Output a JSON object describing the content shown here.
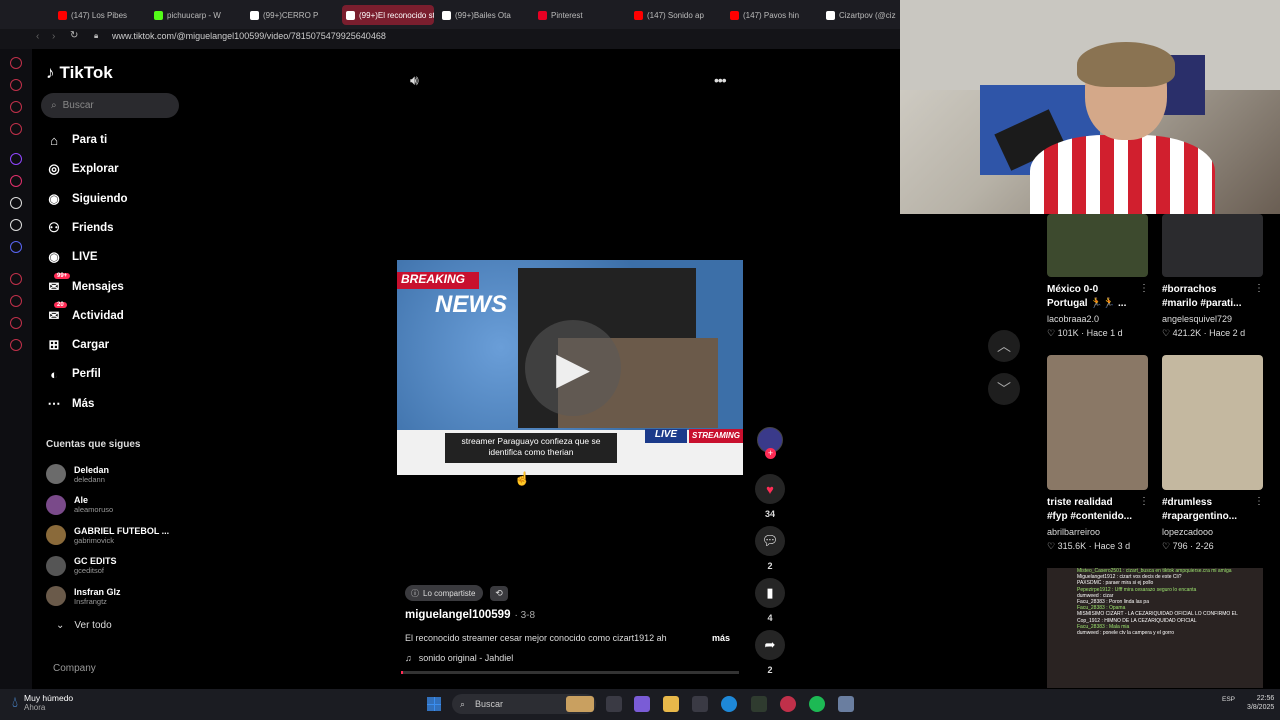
{
  "browser": {
    "tabs": [
      {
        "label": "(147) Los Pibes",
        "color": "#ff0000"
      },
      {
        "label": "pichuucarp - W",
        "color": "#53fc18"
      },
      {
        "label": "(99+)CERRO P",
        "color": "#ffffff"
      },
      {
        "label": "(99+)El reconocido st",
        "color": "#ffffff"
      },
      {
        "label": "(99+)Bailes Ota",
        "color": "#ffffff"
      },
      {
        "label": "Pinterest",
        "color": "#e60023"
      },
      {
        "label": "(147) Sonido ap",
        "color": "#ff0000"
      },
      {
        "label": "(147) Pavos hin",
        "color": "#ff0000"
      },
      {
        "label": "Cizartpov (@ciz",
        "color": "#ffffff"
      }
    ],
    "url": "www.tiktok.com/@miguelangel100599/video/7815075479925640468"
  },
  "tiktok": {
    "logo": "TikTok",
    "search_placeholder": "Buscar",
    "nav": [
      {
        "label": "Para ti",
        "icon": "home-icon"
      },
      {
        "label": "Explorar",
        "icon": "compass-icon"
      },
      {
        "label": "Siguiendo",
        "icon": "following-icon"
      },
      {
        "label": "Friends",
        "icon": "friends-icon"
      },
      {
        "label": "LIVE",
        "icon": "live-icon"
      },
      {
        "label": "Mensajes",
        "icon": "messages-icon",
        "badge": "99+"
      },
      {
        "label": "Actividad",
        "icon": "activity-icon",
        "badge": "20"
      },
      {
        "label": "Cargar",
        "icon": "upload-icon"
      },
      {
        "label": "Perfil",
        "icon": "profile-icon"
      },
      {
        "label": "Más",
        "icon": "more-icon"
      }
    ],
    "following_title": "Cuentas que sigues",
    "following": [
      {
        "name": "Deledan",
        "handle": "deledann",
        "color": "#6b6b6b"
      },
      {
        "name": "Ale",
        "handle": "aleamoruso",
        "color": "#7a4a8a"
      },
      {
        "name": "GABRIEL FUTEBOL ...",
        "handle": "gabrimovick",
        "color": "#8a6a3a"
      },
      {
        "name": "GC EDITS",
        "handle": "gceditsof",
        "color": "#555555"
      },
      {
        "name": "Insfran Glz",
        "handle": "Insfrangtz",
        "color": "#6a5a4a"
      }
    ],
    "see_all": "Ver todo",
    "company": "Company"
  },
  "video": {
    "breaking": "BREAKING",
    "news": "NEWS",
    "caption": "streamer Paraguayo confieza que se identifica como therian",
    "live": "LIVE",
    "streaming": "STREAMING",
    "share_badge": "Lo compartiste",
    "author": "miguelangel100599",
    "date": "· 3-8",
    "description": "El reconocido streamer cesar mejor conocido como cizart1912 ah",
    "more": "más",
    "sound": "sonido original - Jahdiel",
    "likes": "34",
    "comments": "2",
    "saves": "4",
    "shares": "2",
    "progress": 0.0
  },
  "recommended": [
    {
      "title": "México 0-0 Portugal 🏃🏃 ...",
      "author": "lacobraaa2.0",
      "likes": "101K",
      "age": "Hace 1 d",
      "thumb": "#3d4a2e"
    },
    {
      "title": "#borrachos #marilo #parati...",
      "author": "angelesquivel729",
      "likes": "421.2K",
      "age": "Hace 2 d",
      "thumb": "#2b2b2e"
    },
    {
      "title": "triste realidad #fyp #contenido...",
      "author": "abrilbarreiroo",
      "likes": "315.6K",
      "age": "Hace 3 d",
      "thumb": "#8a7866"
    },
    {
      "title": "#drumless #rapargentino...",
      "author": "lopezcadooo",
      "likes": "796",
      "age": "2-26",
      "thumb": "#c4b8a0"
    }
  ],
  "chat": [
    "Misteo_Casero2501 : cizart_busca en tiktok ampquierse.cra mi amiga",
    "Miguelanget1912 : cizart vos decis de este Cli?",
    "PAXSDMC : paraer mira si ej pollo",
    "Pepezirpe1912 : Ufff mira cesarazo seguro lo encanta",
    "dumweed : cizar",
    "Facu_28383 : Poron linda las pa",
    "Facu_28383 : Opama",
    "MISMISIMO CIZART - LA CEZARIQUIDAD OFICIAL LO CONFIRMO EL",
    "Cop_1912 : HIMNO DE LA CEZARIQUIDAD OFICIAL",
    "Facu_28383 : Mala mia",
    "dumweed : ponele ctv la campera y el gorro"
  ],
  "taskbar": {
    "weather_main": "Muy húmedo",
    "weather_sub": "Ahora",
    "search": "Buscar",
    "lang": "ESP",
    "time": "22:56",
    "date": "3/8/2025"
  }
}
